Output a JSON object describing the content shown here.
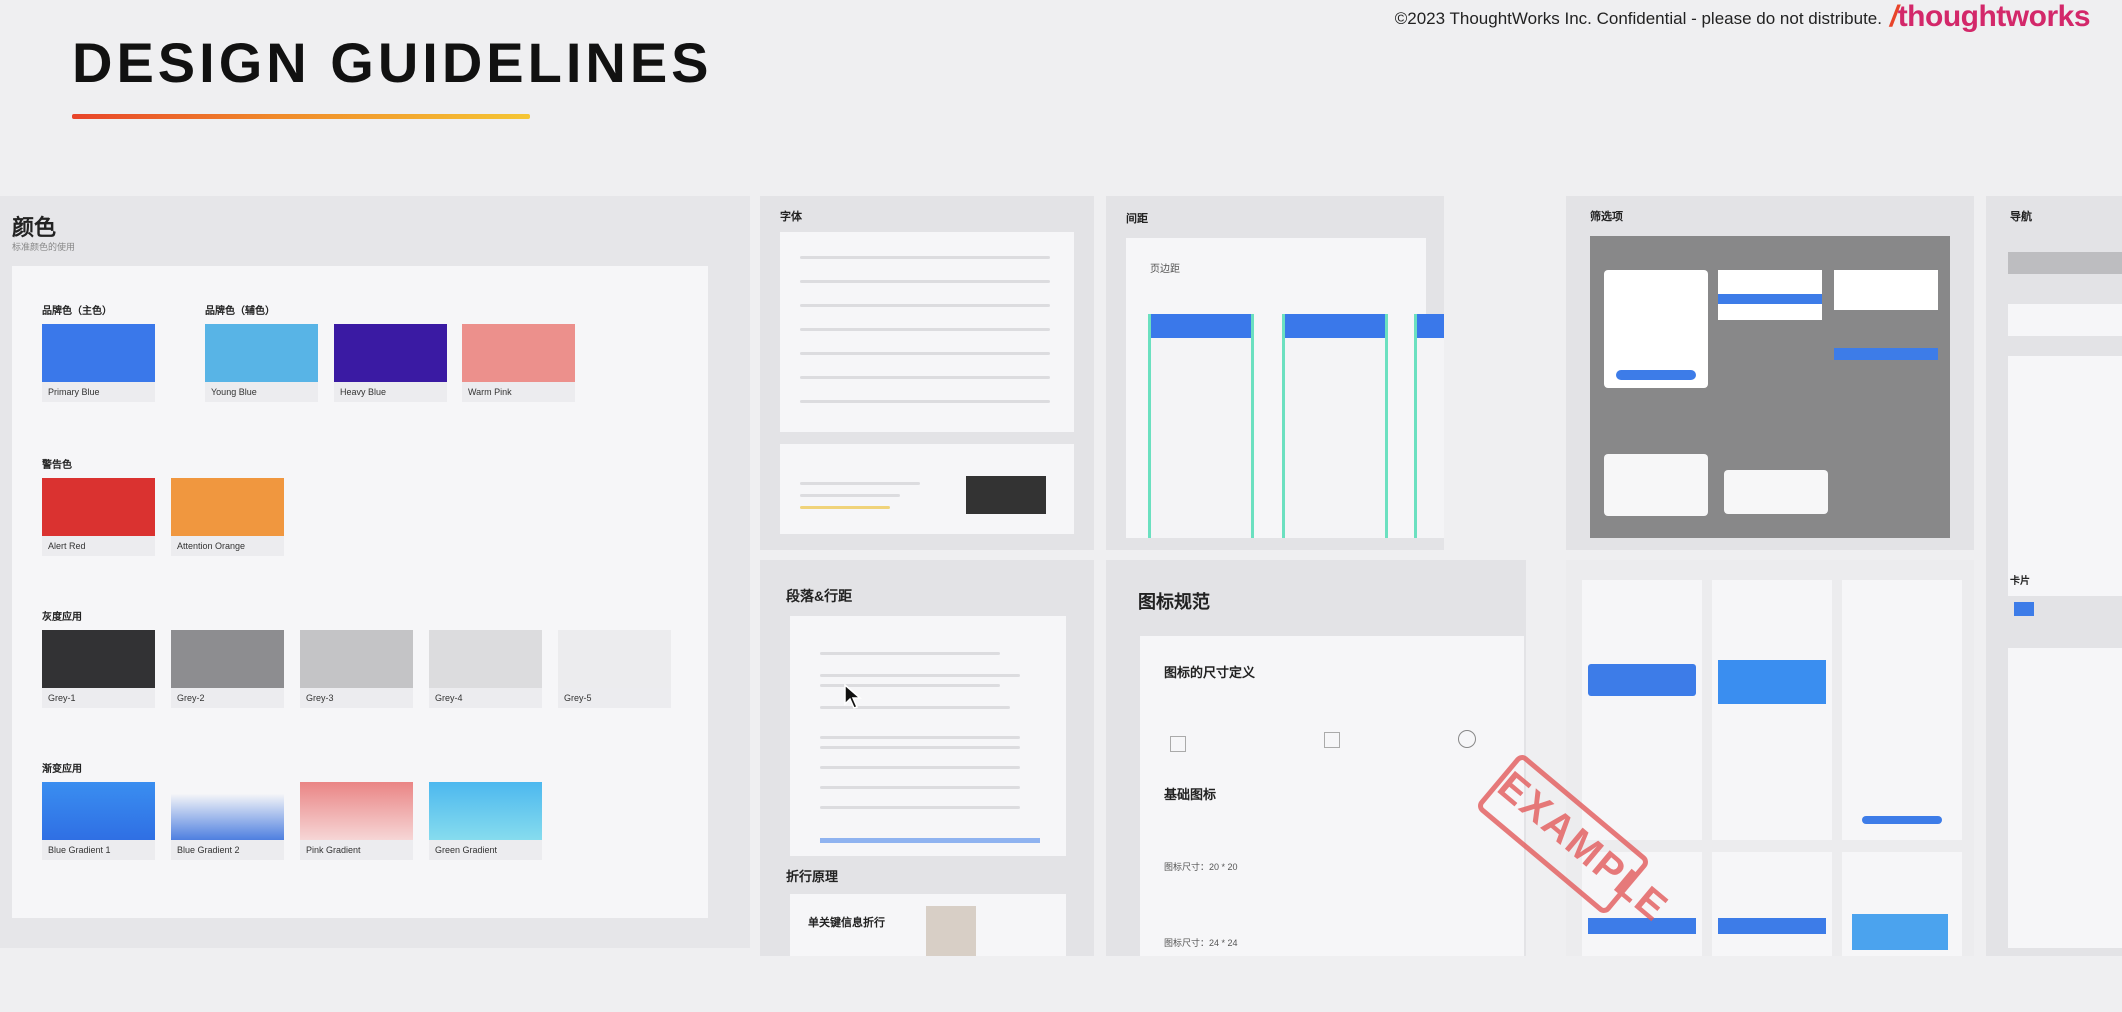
{
  "header": {
    "title": "DESIGN GUIDELINES",
    "confidential": "©2023 ThoughtWorks Inc.  Confidential - please do not distribute.",
    "brand": "thoughtworks"
  },
  "colors_panel": {
    "title": "颜色",
    "subtitle": "标准颜色的使用",
    "brand_primary_label": "品牌色（主色）",
    "brand_secondary_label": "品牌色（辅色）",
    "warning_label": "警告色",
    "gray_label": "灰度应用",
    "gradient_label": "渐变应用",
    "swatches": {
      "primary_blue": "Primary Blue",
      "young_blue": "Young Blue",
      "heavy_blue": "Heavy Blue",
      "warm_pink": "Warm Pink",
      "alert_red": "Alert Red",
      "attention_orange": "Attention Orange",
      "grey1": "Grey-1",
      "grey2": "Grey-2",
      "grey3": "Grey-3",
      "grey4": "Grey-4",
      "grey5": "Grey-5",
      "blue_gradient_1": "Blue Gradient 1",
      "blue_gradient_2": "Blue Gradient 2",
      "pink_gradient": "Pink Gradient",
      "green_gradient": "Green Gradient"
    },
    "swatch_colors": {
      "primary_blue": "#3a78ea",
      "young_blue": "#58b4e6",
      "heavy_blue": "#3a1aa3",
      "warm_pink": "#ec908c",
      "alert_red": "#da3230",
      "attention_orange": "#f0973f",
      "grey1": "#323234",
      "grey2": "#8d8d90",
      "grey3": "#c4c4c6",
      "grey4": "#dcdcde",
      "grey5": "#ececee"
    }
  },
  "typography_panel": {
    "title": "字体"
  },
  "spacing_panel": {
    "title": "间距",
    "sub": "页边距"
  },
  "filter_panel": {
    "title": "筛选项"
  },
  "nav_panel": {
    "title": "导航",
    "card_label": "卡片"
  },
  "paragraph_panel": {
    "title": "段落&行距",
    "wrap_title": "折行原理",
    "wrap_sub": "单关键信息折行"
  },
  "icon_panel": {
    "title": "图标规范",
    "size_title": "图标的尺寸定义",
    "basic_title": "基础图标",
    "size_a": "图标尺寸：20 * 20",
    "size_b": "图标尺寸：24 * 24"
  },
  "stamp": "EXAMPLE"
}
